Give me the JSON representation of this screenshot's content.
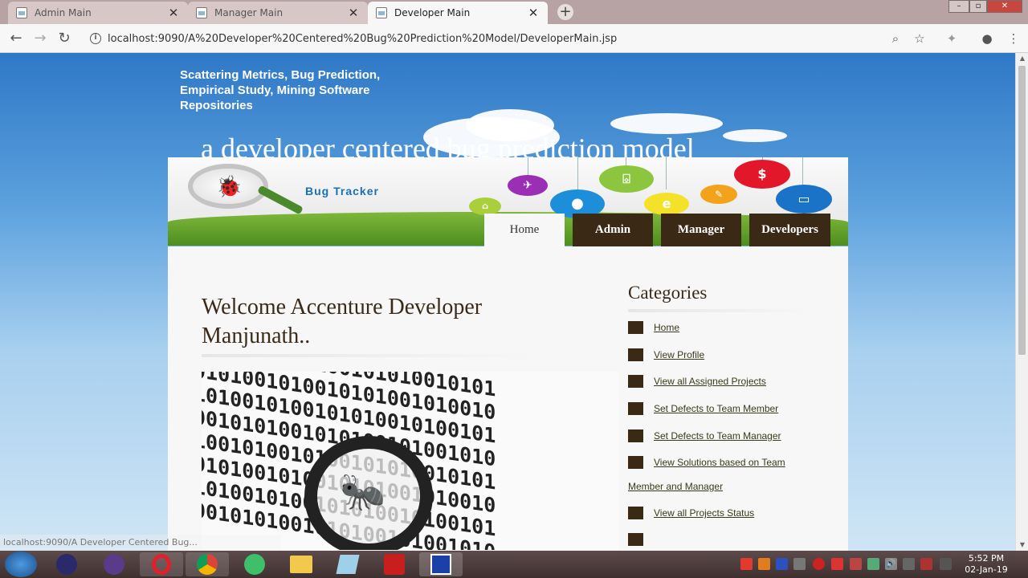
{
  "browser": {
    "tabs": [
      {
        "title": "Admin Main",
        "active": false
      },
      {
        "title": "Manager Main",
        "active": false
      },
      {
        "title": "Developer Main",
        "active": true
      }
    ],
    "url": "localhost:9090/A%20Developer%20Centered%20Bug%20Prediction%20Model/DeveloperMain.jsp",
    "status_url": "localhost:9090/A Developer Centered Bug..."
  },
  "header": {
    "tagline": "Scattering Metrics, Bug Prediction, Empirical Study, Mining Software Repositories",
    "site_title": "a developer centered bug prediction model",
    "logo_text": "Bug Tracker"
  },
  "nav": {
    "home": "Home",
    "admin": "Admin",
    "manager": "Manager",
    "developers": "Developers"
  },
  "main": {
    "welcome": "Welcome Accenture Developer Manjunath.."
  },
  "sidebar": {
    "title": "Categories",
    "items": [
      {
        "label": "Home"
      },
      {
        "label": "View Profile"
      },
      {
        "label": "View all Assigned Projects"
      },
      {
        "label": "Set Defects to Team Member"
      },
      {
        "label": "Set Defects to Team Manager"
      },
      {
        "label": "View Solutions based on Team Member and Manager"
      },
      {
        "label": "View all Projects Status"
      }
    ]
  },
  "taskbar": {
    "time": "5:52 PM",
    "date": "02-Jan-19"
  },
  "colors": {
    "nav_bg": "#3a2a15",
    "link": "#3a3a1a",
    "sky": "#5aa0dd",
    "tabbar": "#b7a3a3"
  }
}
